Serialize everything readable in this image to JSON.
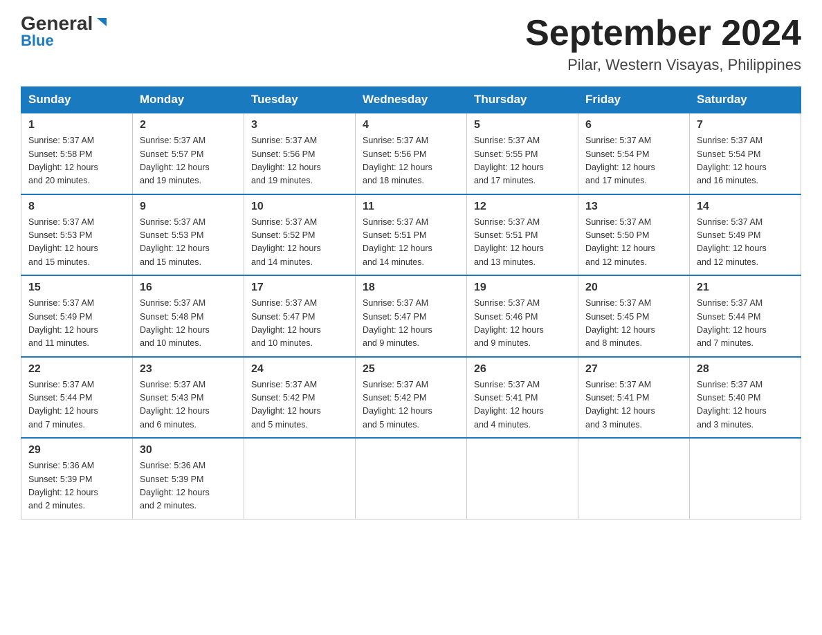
{
  "header": {
    "logo_general": "General",
    "logo_blue": "Blue",
    "title": "September 2024",
    "subtitle": "Pilar, Western Visayas, Philippines"
  },
  "days_of_week": [
    "Sunday",
    "Monday",
    "Tuesday",
    "Wednesday",
    "Thursday",
    "Friday",
    "Saturday"
  ],
  "weeks": [
    [
      {
        "day": "1",
        "sunrise": "5:37 AM",
        "sunset": "5:58 PM",
        "daylight": "12 hours and 20 minutes."
      },
      {
        "day": "2",
        "sunrise": "5:37 AM",
        "sunset": "5:57 PM",
        "daylight": "12 hours and 19 minutes."
      },
      {
        "day": "3",
        "sunrise": "5:37 AM",
        "sunset": "5:56 PM",
        "daylight": "12 hours and 19 minutes."
      },
      {
        "day": "4",
        "sunrise": "5:37 AM",
        "sunset": "5:56 PM",
        "daylight": "12 hours and 18 minutes."
      },
      {
        "day": "5",
        "sunrise": "5:37 AM",
        "sunset": "5:55 PM",
        "daylight": "12 hours and 17 minutes."
      },
      {
        "day": "6",
        "sunrise": "5:37 AM",
        "sunset": "5:54 PM",
        "daylight": "12 hours and 17 minutes."
      },
      {
        "day": "7",
        "sunrise": "5:37 AM",
        "sunset": "5:54 PM",
        "daylight": "12 hours and 16 minutes."
      }
    ],
    [
      {
        "day": "8",
        "sunrise": "5:37 AM",
        "sunset": "5:53 PM",
        "daylight": "12 hours and 15 minutes."
      },
      {
        "day": "9",
        "sunrise": "5:37 AM",
        "sunset": "5:53 PM",
        "daylight": "12 hours and 15 minutes."
      },
      {
        "day": "10",
        "sunrise": "5:37 AM",
        "sunset": "5:52 PM",
        "daylight": "12 hours and 14 minutes."
      },
      {
        "day": "11",
        "sunrise": "5:37 AM",
        "sunset": "5:51 PM",
        "daylight": "12 hours and 14 minutes."
      },
      {
        "day": "12",
        "sunrise": "5:37 AM",
        "sunset": "5:51 PM",
        "daylight": "12 hours and 13 minutes."
      },
      {
        "day": "13",
        "sunrise": "5:37 AM",
        "sunset": "5:50 PM",
        "daylight": "12 hours and 12 minutes."
      },
      {
        "day": "14",
        "sunrise": "5:37 AM",
        "sunset": "5:49 PM",
        "daylight": "12 hours and 12 minutes."
      }
    ],
    [
      {
        "day": "15",
        "sunrise": "5:37 AM",
        "sunset": "5:49 PM",
        "daylight": "12 hours and 11 minutes."
      },
      {
        "day": "16",
        "sunrise": "5:37 AM",
        "sunset": "5:48 PM",
        "daylight": "12 hours and 10 minutes."
      },
      {
        "day": "17",
        "sunrise": "5:37 AM",
        "sunset": "5:47 PM",
        "daylight": "12 hours and 10 minutes."
      },
      {
        "day": "18",
        "sunrise": "5:37 AM",
        "sunset": "5:47 PM",
        "daylight": "12 hours and 9 minutes."
      },
      {
        "day": "19",
        "sunrise": "5:37 AM",
        "sunset": "5:46 PM",
        "daylight": "12 hours and 9 minutes."
      },
      {
        "day": "20",
        "sunrise": "5:37 AM",
        "sunset": "5:45 PM",
        "daylight": "12 hours and 8 minutes."
      },
      {
        "day": "21",
        "sunrise": "5:37 AM",
        "sunset": "5:44 PM",
        "daylight": "12 hours and 7 minutes."
      }
    ],
    [
      {
        "day": "22",
        "sunrise": "5:37 AM",
        "sunset": "5:44 PM",
        "daylight": "12 hours and 7 minutes."
      },
      {
        "day": "23",
        "sunrise": "5:37 AM",
        "sunset": "5:43 PM",
        "daylight": "12 hours and 6 minutes."
      },
      {
        "day": "24",
        "sunrise": "5:37 AM",
        "sunset": "5:42 PM",
        "daylight": "12 hours and 5 minutes."
      },
      {
        "day": "25",
        "sunrise": "5:37 AM",
        "sunset": "5:42 PM",
        "daylight": "12 hours and 5 minutes."
      },
      {
        "day": "26",
        "sunrise": "5:37 AM",
        "sunset": "5:41 PM",
        "daylight": "12 hours and 4 minutes."
      },
      {
        "day": "27",
        "sunrise": "5:37 AM",
        "sunset": "5:41 PM",
        "daylight": "12 hours and 3 minutes."
      },
      {
        "day": "28",
        "sunrise": "5:37 AM",
        "sunset": "5:40 PM",
        "daylight": "12 hours and 3 minutes."
      }
    ],
    [
      {
        "day": "29",
        "sunrise": "5:36 AM",
        "sunset": "5:39 PM",
        "daylight": "12 hours and 2 minutes."
      },
      {
        "day": "30",
        "sunrise": "5:36 AM",
        "sunset": "5:39 PM",
        "daylight": "12 hours and 2 minutes."
      },
      null,
      null,
      null,
      null,
      null
    ]
  ],
  "labels": {
    "sunrise": "Sunrise:",
    "sunset": "Sunset:",
    "daylight": "Daylight:"
  }
}
